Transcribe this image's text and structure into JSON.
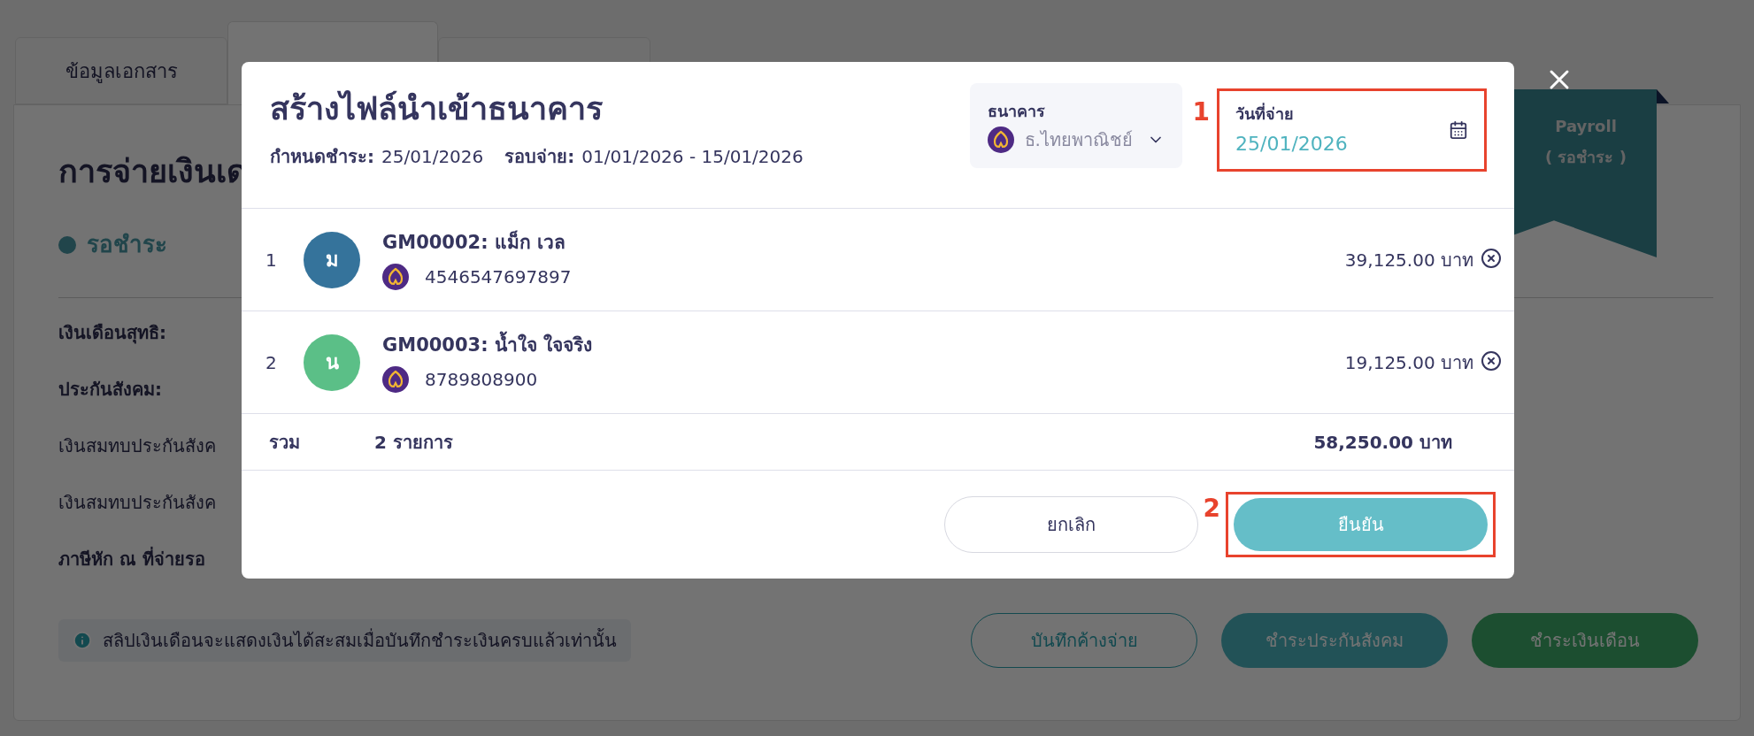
{
  "tabs": [
    {
      "label": "ข้อมูลเอกสาร",
      "selected": false
    },
    {
      "selected": true
    },
    {
      "selected": false
    }
  ],
  "page": {
    "title": "การจ่ายเงินเด",
    "status": "รอชำระ",
    "fields": [
      {
        "label": "เงินเดือนสุทธิ:",
        "kind": "heading"
      },
      {
        "label": "ประกันสังคม:",
        "kind": "heading"
      },
      {
        "label": "เงินสมทบประกันสังค",
        "kind": "item"
      },
      {
        "label": "เงินสมทบประกันสังค",
        "kind": "item"
      },
      {
        "label": "ภาษีหัก ณ ที่จ่ายรอ",
        "kind": "heading"
      }
    ],
    "ribbon": [
      "Payroll",
      "( รอชำระ )"
    ],
    "note": "สลิปเงินเดือนจะแสดงเงินได้สะสมเมื่อบันทึกชำระเงินครบแล้วเท่านั้น",
    "actions": [
      {
        "label": "บันทึกค้างจ่าย",
        "kind": "outline"
      },
      {
        "label": "ชำระประกันสังคม",
        "kind": "teal"
      },
      {
        "label": "ชำระเงินเดือน",
        "kind": "green"
      }
    ]
  },
  "dialog": {
    "title": "สร้างไฟล์นำเข้าธนาคาร",
    "due_label": "กำหนดชำระ:",
    "due": "25/01/2026",
    "cycle_label": "รอบจ่าย:",
    "cycle": "01/01/2026 - 15/01/2026",
    "bank": {
      "label": "ธนาคาร",
      "value": "ธ.ไทยพาณิชย์"
    },
    "date": {
      "label": "วันที่จ่าย",
      "value": "25/01/2026",
      "annotation": "1"
    },
    "rows": [
      {
        "index": "1",
        "initial": "ม",
        "color": "#35739b",
        "name": "GM00002: แม็ก เวล",
        "account": "4546547697897",
        "amount": "39,125.00 บาท"
      },
      {
        "index": "2",
        "initial": "น",
        "color": "#5bbf87",
        "name": "GM00003: น้ำใจ ใจจริง",
        "account": "8789808900",
        "amount": "19,125.00 บาท"
      }
    ],
    "total": {
      "label": "รวม",
      "count": "2 รายการ",
      "amount": "58,250.00 บาท"
    },
    "cancel": "ยกเลิก",
    "confirm": {
      "label": "ยืนยัน",
      "annotation": "2"
    }
  }
}
